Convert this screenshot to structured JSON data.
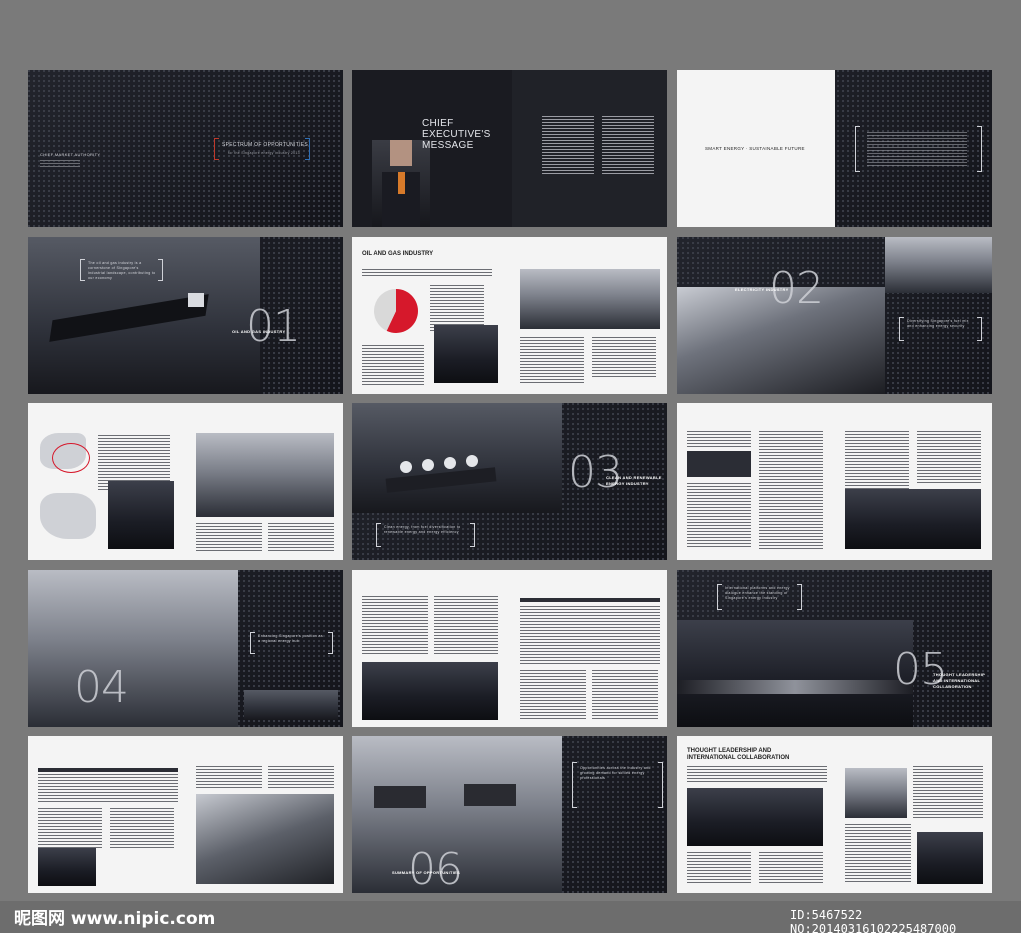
{
  "spreads": {
    "s1": {
      "left_text": "CHIEF MARKET AUTHORITY",
      "left_sub": "Energy Market Authority",
      "title": "SPECTRUM OF OPPORTUNITIES",
      "subtitle": "for the Singapore energy industry 2013"
    },
    "s2": {
      "title": "CHIEF EXECUTIVE'S MESSAGE"
    },
    "s3": {
      "tagline": "SMART ENERGY · SUSTAINABLE FUTURE"
    },
    "s4": {
      "number": "01",
      "section": "OIL AND GAS INDUSTRY",
      "quote": "The oil and gas industry is a cornerstone of Singapore's industrial landscape, contributing to our economy"
    },
    "s5": {
      "heading": "OIL AND GAS INDUSTRY"
    },
    "s6": {
      "number": "02",
      "section": "ELECTRICITY INDUSTRY",
      "quote": "Diversifying Singapore's fuel mix and enhancing energy security"
    },
    "s8": {
      "number": "03",
      "section": "CLEAN AND RENEWABLE ENERGY INDUSTRY",
      "quote": "Clean energy, from fuel diversification to renewable energy and energy efficiency"
    },
    "s10": {
      "number": "04",
      "quote": "Enhancing Singapore's position as a regional energy hub"
    },
    "s12": {
      "number": "05",
      "section": "THOUGHT LEADERSHIP AND INTERNATIONAL COLLABORATION",
      "quote": "International platforms and energy dialogue enhance the standing of Singapore's energy industry"
    },
    "s14": {
      "number": "06",
      "section": "SUMMARY OF OPPORTUNITIES",
      "quote": "Opportunities across the industry and growing demand for skilled energy professionals"
    },
    "s15": {
      "heading": "THOUGHT LEADERSHIP AND INTERNATIONAL COLLABORATION"
    }
  },
  "pie": {
    "values": [
      57,
      43
    ],
    "colors": [
      "#d6182b",
      "#d9d9d9"
    ]
  },
  "watermark": {
    "site": "昵图网 www.nipic.com",
    "id": "ID:5467522 NO:20140316102225487000"
  }
}
